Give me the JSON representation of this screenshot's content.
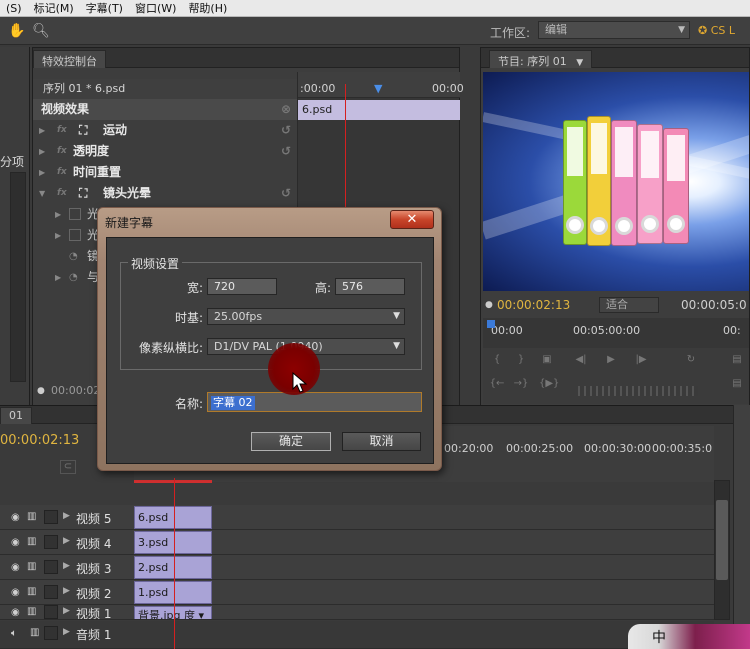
{
  "menubar": {
    "items": [
      "(S)",
      "标记(M)",
      "字幕(T)",
      "窗口(W)",
      "帮助(H)"
    ]
  },
  "toolbar": {
    "workspace_label": "工作区:",
    "workspace_value": "编辑",
    "logo_text": "CS L",
    "icons": [
      "hand-icon",
      "zoom-icon"
    ]
  },
  "left_panel": {
    "label": "分项"
  },
  "effects_panel": {
    "tab": "特效控制台",
    "sequence_label": "序列 01 * 6.psd",
    "section_title": "视频效果",
    "effects": [
      "运动",
      "透明度",
      "时间重置",
      "镜头光晕"
    ],
    "sub_props": [
      "光",
      "光",
      "镜",
      "与"
    ],
    "timeline_start": ":00:00",
    "timeline_end": "00:00",
    "clip_label": "6.psd",
    "bottom_timecode": "00:00:02"
  },
  "program_panel": {
    "tab": "节目: 序列 01",
    "timecode": "00:00:02:13",
    "fit_value": "适合",
    "timecode_end": "00:00:05:0",
    "ruler_start": "00:00",
    "ruler_mid": "00:05:00:00",
    "ruler_end": "00:"
  },
  "timeline": {
    "tab": "01",
    "timecode": "00:00:02:13",
    "ruler_labels": [
      "00:20:00",
      "00:00:25:00",
      "00:00:30:00",
      "00:00:35:0"
    ],
    "tracks": [
      {
        "name": "视频 5",
        "clip": "6.psd"
      },
      {
        "name": "视频 4",
        "clip": "3.psd"
      },
      {
        "name": "视频 3",
        "clip": "2.psd"
      },
      {
        "name": "视频 2",
        "clip": "1.psd"
      },
      {
        "name": "视频 1",
        "clip": "背景.jpg 度 ▾"
      },
      {
        "name": "音频 1",
        "clip": ""
      }
    ]
  },
  "dialog": {
    "title": "新建字幕",
    "close_label": "✕",
    "group_title": "视频设置",
    "width_label": "宽:",
    "width_value": "720",
    "height_label": "高:",
    "height_value": "576",
    "timebase_label": "时基:",
    "timebase_value": "25.00fps",
    "pixel_aspect_label": "像素纵横比:",
    "pixel_aspect_value": "D1/DV PAL (1.0940)",
    "name_label": "名称:",
    "name_value": "字幕 02",
    "ok_label": "确定",
    "cancel_label": "取消"
  },
  "tray": {
    "ime": "中"
  },
  "colors": {
    "accent_timecode": "#e0b540",
    "clip_fill": "#a9a3d6",
    "playhead": "#d42020",
    "dialog_frame": "#a28572",
    "close_button": "#c8452a"
  }
}
